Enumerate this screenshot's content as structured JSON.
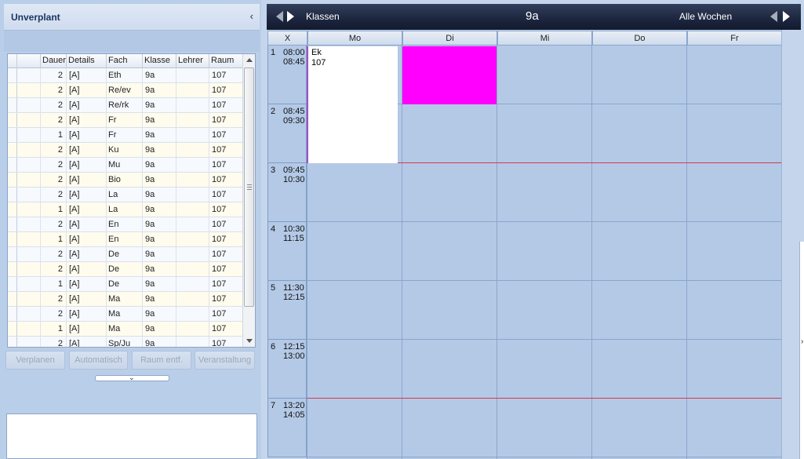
{
  "left_panel": {
    "title": "Unverplant",
    "collapse_icon": "‹",
    "columns": [
      "Dauer",
      "Details",
      "Fach",
      "Klasse",
      "Lehrer",
      "Raum"
    ],
    "rows": [
      {
        "dauer": "2",
        "details": "[A]",
        "fach": "Eth",
        "klasse": "9a",
        "lehrer": "",
        "raum": "107"
      },
      {
        "dauer": "2",
        "details": "[A]",
        "fach": "Re/ev",
        "klasse": "9a",
        "lehrer": "",
        "raum": "107"
      },
      {
        "dauer": "2",
        "details": "[A]",
        "fach": "Re/rk",
        "klasse": "9a",
        "lehrer": "",
        "raum": "107"
      },
      {
        "dauer": "2",
        "details": "[A]",
        "fach": "Fr",
        "klasse": "9a",
        "lehrer": "",
        "raum": "107"
      },
      {
        "dauer": "1",
        "details": "[A]",
        "fach": "Fr",
        "klasse": "9a",
        "lehrer": "",
        "raum": "107"
      },
      {
        "dauer": "2",
        "details": "[A]",
        "fach": "Ku",
        "klasse": "9a",
        "lehrer": "",
        "raum": "107"
      },
      {
        "dauer": "2",
        "details": "[A]",
        "fach": "Mu",
        "klasse": "9a",
        "lehrer": "",
        "raum": "107"
      },
      {
        "dauer": "2",
        "details": "[A]",
        "fach": "Bio",
        "klasse": "9a",
        "lehrer": "",
        "raum": "107"
      },
      {
        "dauer": "2",
        "details": "[A]",
        "fach": "La",
        "klasse": "9a",
        "lehrer": "",
        "raum": "107"
      },
      {
        "dauer": "1",
        "details": "[A]",
        "fach": "La",
        "klasse": "9a",
        "lehrer": "",
        "raum": "107"
      },
      {
        "dauer": "2",
        "details": "[A]",
        "fach": "En",
        "klasse": "9a",
        "lehrer": "",
        "raum": "107"
      },
      {
        "dauer": "1",
        "details": "[A]",
        "fach": "En",
        "klasse": "9a",
        "lehrer": "",
        "raum": "107"
      },
      {
        "dauer": "2",
        "details": "[A]",
        "fach": "De",
        "klasse": "9a",
        "lehrer": "",
        "raum": "107"
      },
      {
        "dauer": "2",
        "details": "[A]",
        "fach": "De",
        "klasse": "9a",
        "lehrer": "",
        "raum": "107"
      },
      {
        "dauer": "1",
        "details": "[A]",
        "fach": "De",
        "klasse": "9a",
        "lehrer": "",
        "raum": "107"
      },
      {
        "dauer": "2",
        "details": "[A]",
        "fach": "Ma",
        "klasse": "9a",
        "lehrer": "",
        "raum": "107"
      },
      {
        "dauer": "2",
        "details": "[A]",
        "fach": "Ma",
        "klasse": "9a",
        "lehrer": "",
        "raum": "107"
      },
      {
        "dauer": "1",
        "details": "[A]",
        "fach": "Ma",
        "klasse": "9a",
        "lehrer": "",
        "raum": "107"
      },
      {
        "dauer": "2",
        "details": "[A]",
        "fach": "Sp/Ju",
        "klasse": "9a",
        "lehrer": "",
        "raum": "107"
      }
    ],
    "buttons": {
      "verplanen": "Verplanen",
      "automatisch": "Automatisch",
      "raum_entf": "Raum entf.",
      "veranstaltung": "Veranstaltung"
    },
    "splitter_icon": "⌄"
  },
  "timetable": {
    "nav_left_label": "Klassen",
    "class_name": "9a",
    "weeks_label": "Alle Wochen",
    "corner_label": "X",
    "days": [
      "Mo",
      "Di",
      "Mi",
      "Do",
      "Fr"
    ],
    "periods": [
      {
        "num": "1",
        "start": "08:00",
        "end": "08:45"
      },
      {
        "num": "2",
        "start": "08:45",
        "end": "09:30"
      },
      {
        "num": "3",
        "start": "09:45",
        "end": "10:30"
      },
      {
        "num": "4",
        "start": "10:30",
        "end": "11:15"
      },
      {
        "num": "5",
        "start": "11:30",
        "end": "12:15"
      },
      {
        "num": "6",
        "start": "12:15",
        "end": "13:00"
      },
      {
        "num": "7",
        "start": "13:20",
        "end": "14:05"
      }
    ],
    "lessons": [
      {
        "day": "Mo",
        "fach": "Ek",
        "raum": "107",
        "color": "#ffffff"
      },
      {
        "day": "Di",
        "color": "#ff00ff"
      }
    ],
    "colors": {
      "highlight": "#ff00ff",
      "break_line": "#d43a53",
      "header_bar": "#1d2740"
    }
  }
}
